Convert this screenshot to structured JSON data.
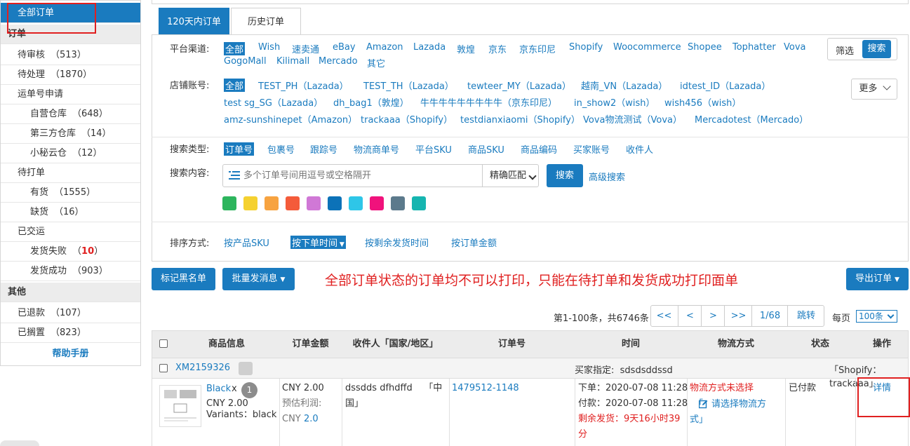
{
  "sidebar": {
    "all_orders": "全部订单",
    "section_orders": "订单",
    "pending_review": "待审核",
    "pending_review_count": "（513）",
    "pending_process": "待处理",
    "pending_process_count": "（1870）",
    "waybill_apply": "运单号申请",
    "own_warehouse": "自营仓库",
    "own_warehouse_count": "（648）",
    "third_warehouse": "第三方仓库",
    "third_warehouse_count": "（14）",
    "xiaomi_cloud": "小秘云仓",
    "xiaomi_cloud_count": "（12）",
    "to_print": "待打单",
    "in_stock": "有货",
    "in_stock_count": "（1555）",
    "out_of_stock": "缺货",
    "out_of_stock_count": "（16）",
    "shipped": "已交运",
    "ship_failed": "发货失败",
    "ship_failed_open": "（",
    "ship_failed_count": "10",
    "ship_failed_close": "）",
    "ship_success": "发货成功",
    "ship_success_count": "（903）",
    "section_other": "其他",
    "refunded": "已退款",
    "refunded_count": "（107）",
    "shelved": "已搁置",
    "shelved_count": "（823）",
    "help": "帮助手册"
  },
  "tabs": {
    "recent": "120天内订单",
    "history": "历史订单"
  },
  "filters": {
    "platform_label": "平台渠道:",
    "platforms": [
      "全部",
      "Wish",
      "速卖通",
      "eBay",
      "Amazon",
      "Lazada",
      "敦煌",
      "京东",
      "京东印尼",
      "Shopify",
      "Woocommerce",
      "Shopee",
      "Tophatter",
      "Vova",
      "GogoMall",
      "Kilimall",
      "Mercado",
      "其它"
    ],
    "screen_btn": "筛选",
    "search_btn_top": "搜索",
    "store_label": "店铺账号:",
    "stores": [
      "全部",
      "TEST_PH（Lazada）",
      "TEST_TH（Lazada）",
      "tewteer_MY（Lazada）",
      "越南_VN（Lazada）",
      "idtest_ID（Lazada）",
      "test sg_SG（Lazada）",
      "dh_bag1（敦煌）",
      "牛牛牛牛牛牛牛牛牛（京东印尼）",
      "in_show2（wish）",
      "wish456（wish）",
      "amz-sunshinepet（Amazon）",
      "trackaaa（Shopify）",
      "testdianxiaomi（Shopify）",
      "Vova物流测试（Vova）",
      "Mercadotest（Mercado）"
    ],
    "more_btn": "更多",
    "search_type_label": "搜索类型:",
    "search_types": [
      "订单号",
      "包裹号",
      "跟踪号",
      "物流商单号",
      "平台SKU",
      "商品SKU",
      "商品编码",
      "买家账号",
      "收件人"
    ],
    "search_content_label": "搜索内容:",
    "search_placeholder": "多个订单号间用逗号或空格隔开",
    "match_select": "精确匹配",
    "search_btn": "搜索",
    "advanced_search": "高级搜索",
    "color_tags": [
      "#2db55d",
      "#f5d130",
      "#f7a340",
      "#f45b3a",
      "#d078d6",
      "#0c72b8",
      "#2ec6e8",
      "#f0127c",
      "#5c7a8c",
      "#16b5b0"
    ],
    "sort_label": "排序方式:",
    "sorts": [
      "按产品SKU",
      "按下单时间",
      "按剩余发货时间",
      "按订单金额"
    ]
  },
  "actions": {
    "blacklist": "标记黑名单",
    "bulk_message": "批量发消息",
    "notice": "全部订单状态的订单均不可以打印，只能在待打单和发货成功打印面单",
    "export": "导出订单"
  },
  "pagination": {
    "summary": "第1-100条，共6746条",
    "first": "<<",
    "prev": "<",
    "next": ">",
    "last": ">>",
    "page": "1/68",
    "jump": "跳转",
    "per_page_label": "每页",
    "per_page": "100条"
  },
  "table": {
    "headers": [
      "商品信息",
      "订单金额",
      "收件人「国家/地区」",
      "订单号",
      "时间",
      "物流方式",
      "状态",
      "操作"
    ],
    "group": {
      "order_id": "XM2159326",
      "buyer_specified": "买家指定:  sdsdsddssd",
      "shop": "「Shopify：trackaaa」"
    },
    "row": {
      "product_name": "Black",
      "product_x": "x",
      "qty": "1",
      "product_price": "CNY 2.00",
      "variants": "Variants：black",
      "amount": "CNY 2.00",
      "profit_label": "预估利润:",
      "profit_currency": "CNY",
      "profit_value": "2.0",
      "recipient_line1": "dssdds dfhdffd    「中",
      "recipient_line2": "国」",
      "order_no": "1479512-1148",
      "order_time": "下单：2020-07-08 11:28",
      "pay_time": "付款：2020-07-08 11:28",
      "remaining_line1": "剩余发货：9天16小时39",
      "remaining_line2": "分",
      "logistics_warn": "物流方式未选择",
      "logistics_choose_open": "「",
      "logistics_choose_line1": "请选择物流方",
      "logistics_choose_line2": "式」",
      "status": "已付款",
      "detail": "详情"
    }
  }
}
